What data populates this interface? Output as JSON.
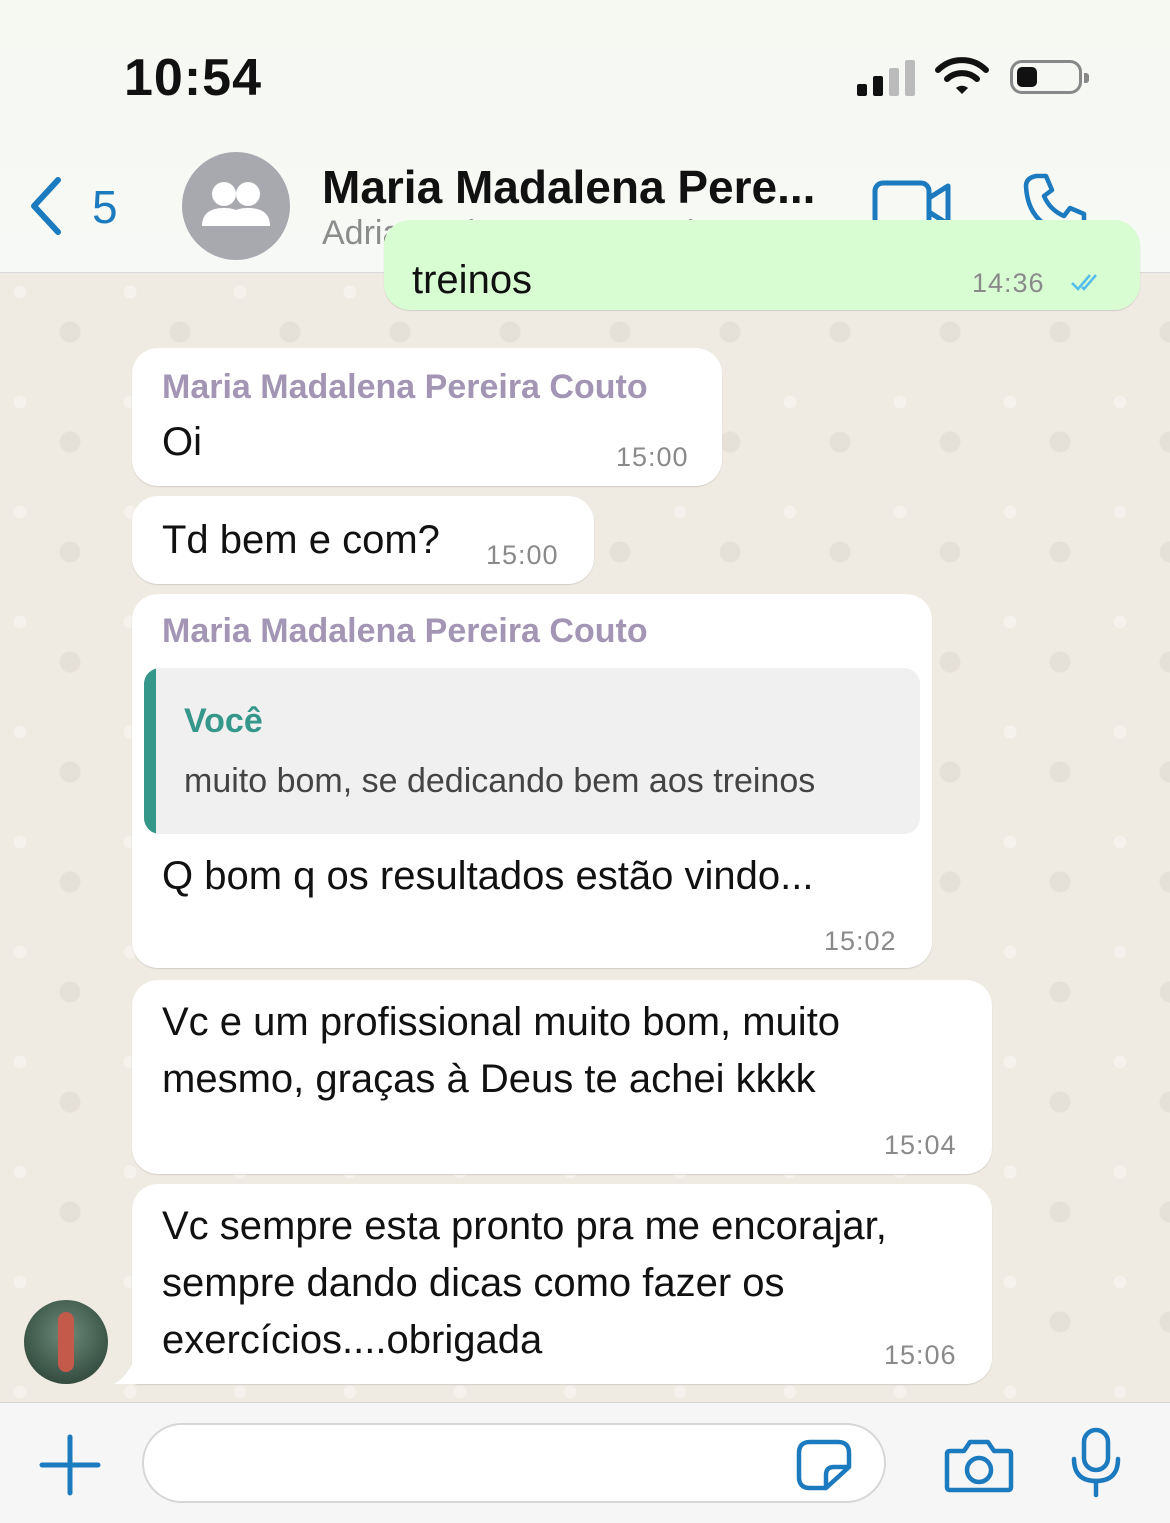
{
  "status_bar": {
    "time": "10:54"
  },
  "header": {
    "back_count": "5",
    "title": "Maria Madalena Pere...",
    "subtitle": "Adrian Lubenow pessoal, Ma..."
  },
  "messages": [
    {
      "type": "outgoing",
      "partial_text": "treinos",
      "time": "14:36",
      "status": "read"
    },
    {
      "type": "incoming",
      "sender": "Maria Madalena Pereira Couto",
      "text": "Oi",
      "time": "15:00"
    },
    {
      "type": "incoming",
      "text": "Td bem e com?",
      "time": "15:00"
    },
    {
      "type": "incoming",
      "sender": "Maria Madalena Pereira Couto",
      "quote": {
        "author": "Você",
        "text": "muito bom, se dedicando bem aos treinos"
      },
      "text": "Q bom q os resultados estão vindo...",
      "time": "15:02"
    },
    {
      "type": "incoming",
      "lines": [
        "Vc e um profissional muito bom, muito",
        "mesmo, graças à Deus te achei kkkk"
      ],
      "time": "15:04"
    },
    {
      "type": "incoming",
      "lines": [
        "Vc sempre esta pronto pra me encorajar,",
        "sempre dando dicas como fazer os",
        "exercícios....obrigada"
      ],
      "time": "15:06"
    }
  ],
  "icons": {
    "back": "chevron-left-icon",
    "group": "group-icon",
    "video": "video-camera-icon",
    "phone": "phone-icon",
    "plus": "plus-icon",
    "sticker": "sticker-icon",
    "camera": "camera-icon",
    "mic": "microphone-icon"
  },
  "colors": {
    "accent": "#1c7abf",
    "sender_name": "#a395b4",
    "quote_accent": "#35968a",
    "outgoing_bubble": "#d9fdd3",
    "read_ticks": "#53bdeb"
  }
}
